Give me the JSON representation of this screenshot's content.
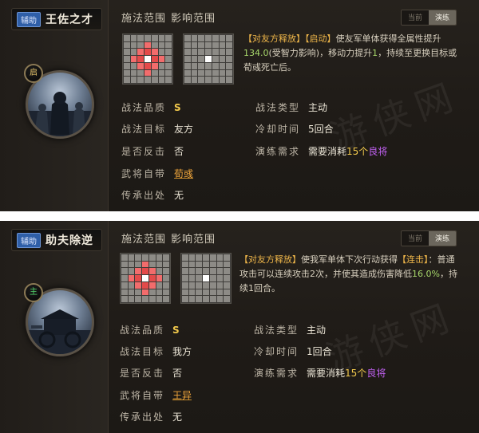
{
  "panels": [
    {
      "tag": "辅助",
      "name": "王佐之才",
      "badge": "启",
      "heads": {
        "cast_range": "施法范围",
        "effect_range": "影响范围"
      },
      "toggle": {
        "off": "当前",
        "on": "演练"
      },
      "desc": {
        "p1": "【对友方释放】",
        "p2": "【启动】",
        "p3": "使友军单体获得全属性提升",
        "n1": "134.0",
        "p4": "(受智力影响)，移动力提升",
        "n2": "1",
        "p5": "，持续至更换目标或荀彧死亡后。"
      },
      "stats": {
        "quality_label": "战法品质",
        "quality": "S",
        "type_label": "战法类型",
        "type": "主动",
        "target_label": "战法目标",
        "target": "友方",
        "cooldown_label": "冷却时间",
        "cooldown": "5回合",
        "counter_label": "是否反击",
        "counter": "否",
        "drill_label": "演练需求",
        "drill_pre": "需要消耗",
        "drill_count": "15个",
        "drill_item": "良将",
        "owner_label": "武将自带",
        "owner": "荀彧",
        "inherit_label": "传承出处",
        "inherit": "无"
      }
    },
    {
      "tag": "辅助",
      "name": "助夫除逆",
      "badge": "主",
      "heads": {
        "cast_range": "施法范围",
        "effect_range": "影响范围"
      },
      "toggle": {
        "off": "当前",
        "on": "演练"
      },
      "desc": {
        "p1": "【对友方释放】",
        "p2": "使我军单体下次行动获得",
        "p3": "【连击】",
        "p4": "：普通攻击可以连续攻击2次，并使其造成伤害降低",
        "n1": "16.0%",
        "p5": "，持续1回合。"
      },
      "stats": {
        "quality_label": "战法品质",
        "quality": "S",
        "type_label": "战法类型",
        "type": "主动",
        "target_label": "战法目标",
        "target": "我方",
        "cooldown_label": "冷却时间",
        "cooldown": "1回合",
        "counter_label": "是否反击",
        "counter": "否",
        "drill_label": "演练需求",
        "drill_pre": "需要消耗",
        "drill_count": "15个",
        "drill_item": "良将",
        "owner_label": "武将自带",
        "owner": "王异",
        "inherit_label": "传承出处",
        "inherit": "无"
      }
    }
  ],
  "watermark": "游侠网",
  "colors": {
    "panel_bg": "#231f1a",
    "accent_gold": "#f2c94c",
    "accent_orange": "#f0a63c",
    "accent_purple": "#c060f0",
    "range_red": "#d63a3a"
  }
}
